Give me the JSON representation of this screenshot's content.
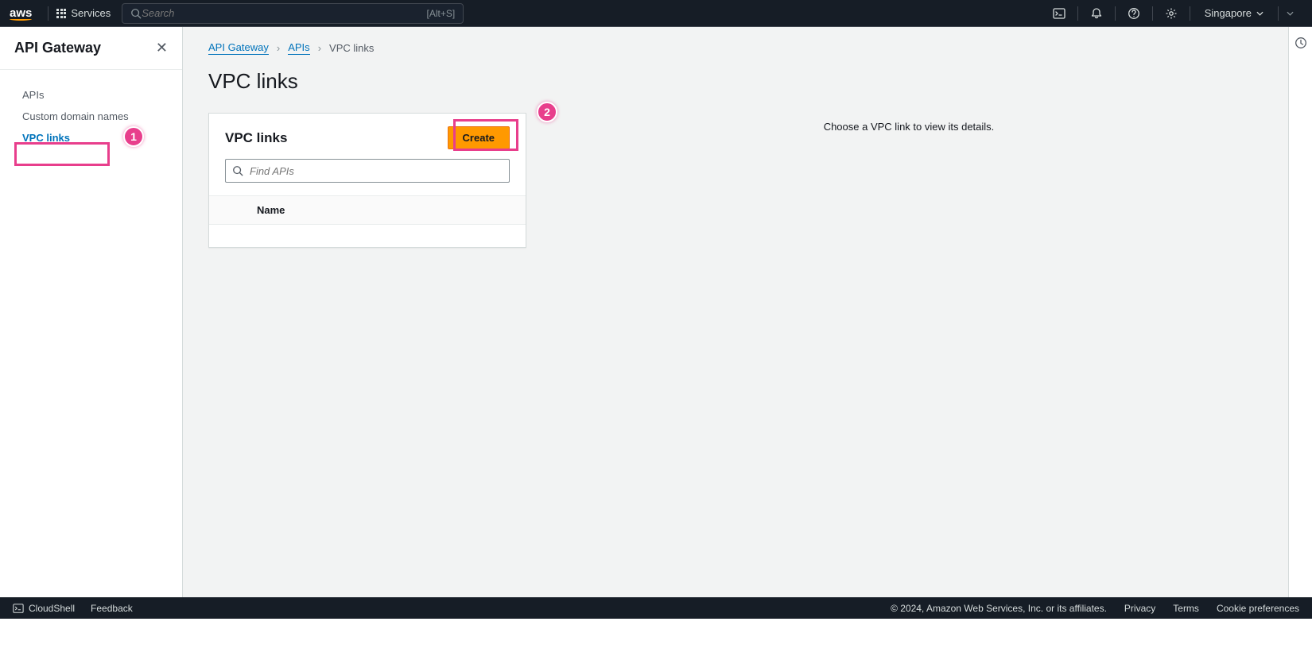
{
  "topnav": {
    "logo_text": "aws",
    "services_label": "Services",
    "search_placeholder": "Search",
    "search_shortcut": "[Alt+S]",
    "region": "Singapore"
  },
  "sidebar": {
    "title": "API Gateway",
    "items": [
      {
        "label": "APIs",
        "active": false
      },
      {
        "label": "Custom domain names",
        "active": false
      },
      {
        "label": "VPC links",
        "active": true
      }
    ]
  },
  "breadcrumbs": {
    "items": [
      {
        "label": "API Gateway",
        "link": true
      },
      {
        "label": "APIs",
        "link": true
      },
      {
        "label": "VPC links",
        "link": false
      }
    ]
  },
  "page": {
    "title": "VPC links"
  },
  "panel": {
    "title": "VPC links",
    "create_label": "Create",
    "search_placeholder": "Find APIs",
    "columns": {
      "name": "Name"
    }
  },
  "detail": {
    "empty_text": "Choose a VPC link to view its details."
  },
  "annotations": {
    "c1": "1",
    "c2": "2"
  },
  "footer": {
    "cloudshell": "CloudShell",
    "feedback": "Feedback",
    "copyright": "© 2024, Amazon Web Services, Inc. or its affiliates.",
    "privacy": "Privacy",
    "terms": "Terms",
    "cookies": "Cookie preferences"
  }
}
